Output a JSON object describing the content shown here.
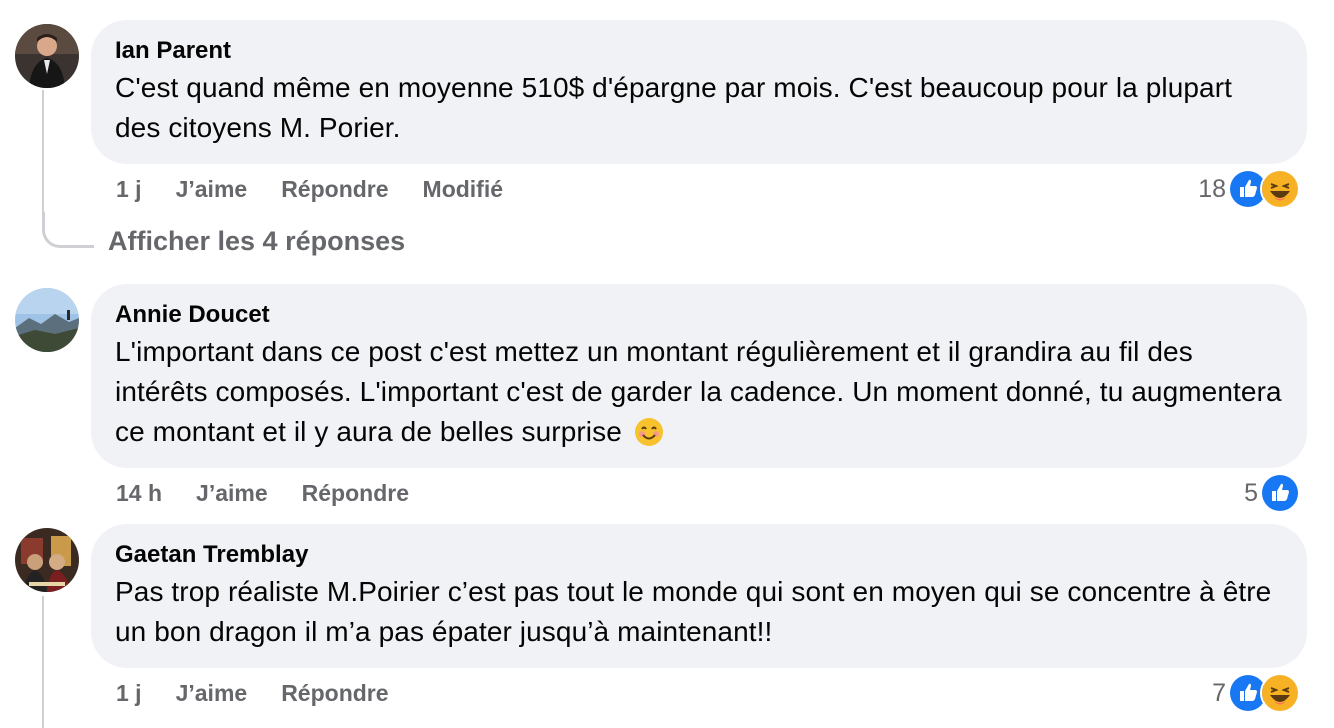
{
  "comments": [
    {
      "author": "Ian Parent",
      "text": "C'est quand même en moyenne 510$ d'épargne par mois. C'est beaucoup pour la plupart des citoyens M. Porier.",
      "time": "1 j",
      "like_label": "J’aime",
      "reply_label": "Répondre",
      "edited_label": "Modifié",
      "reaction_count": "18",
      "reactions": [
        "like-icon",
        "haha-icon"
      ]
    },
    {
      "author": "Annie Doucet",
      "text": "L'important dans ce post c'est mettez un montant régulièrement et il grandira au fil des intérêts composés. L'important c'est de garder la cadence. Un moment donné, tu augmentera ce montant et il y aura de belles surprise",
      "emoji": "smiling-face-icon",
      "time": "14 h",
      "like_label": "J’aime",
      "reply_label": "Répondre",
      "reaction_count": "5",
      "reactions": [
        "like-icon"
      ]
    },
    {
      "author": "Gaetan Tremblay",
      "text": "Pas trop réaliste M.Poirier c’est pas tout le monde qui sont en moyen qui se concentre à être un bon dragon il m’a pas épater jusqu’à maintenant!!",
      "time": "1 j",
      "like_label": "J’aime",
      "reply_label": "Répondre",
      "reaction_count": "7",
      "reactions": [
        "like-icon",
        "haha-icon"
      ]
    }
  ],
  "view_replies_label": "Afficher les 4 réponses",
  "colors": {
    "bubble": "#f0f2f5",
    "secondary_text": "#65676b",
    "like_blue": "#1877f2",
    "haha_yellow": "#f7b125"
  }
}
